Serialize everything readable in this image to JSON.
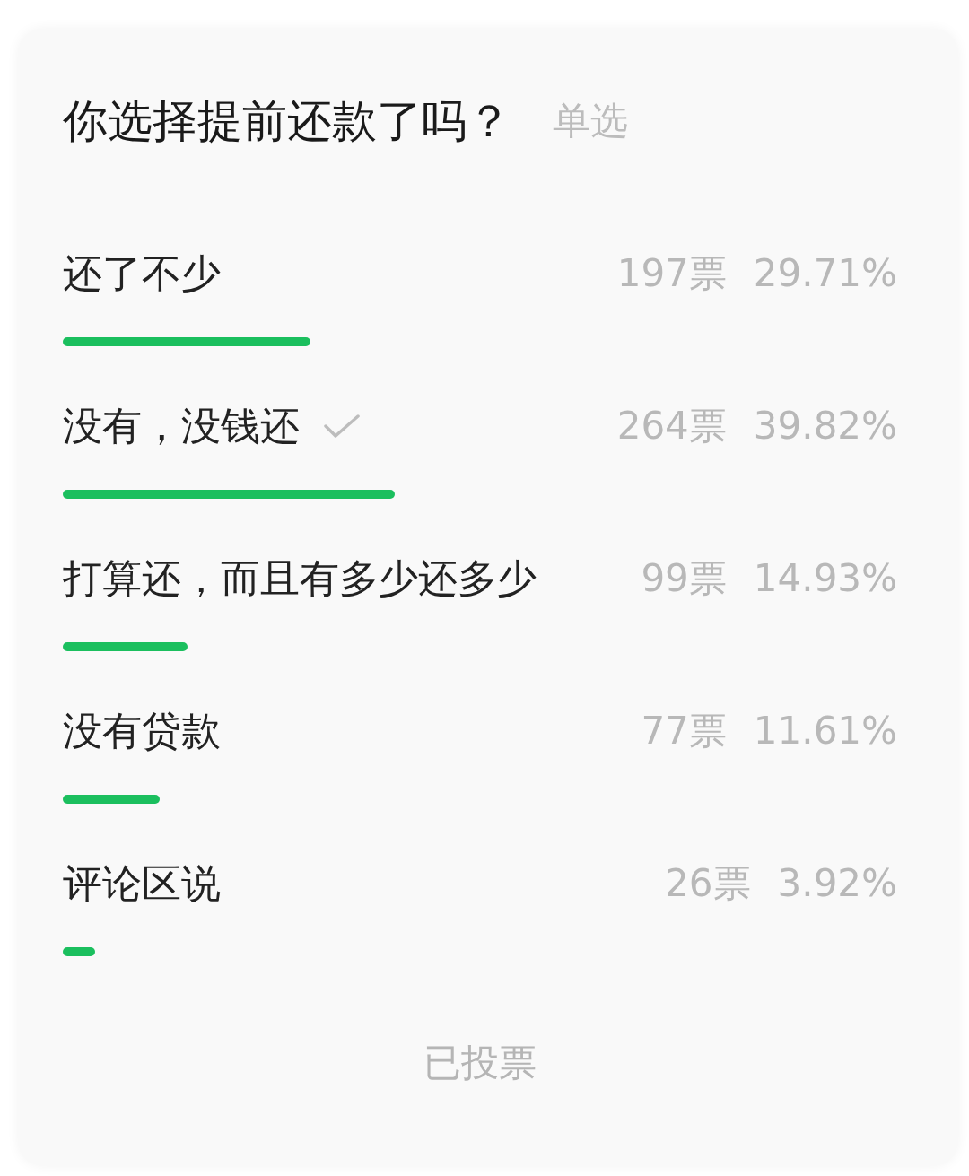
{
  "poll": {
    "question": "你选择提前还款了吗？",
    "mode": "单选",
    "options": [
      {
        "label": "还了不少",
        "votes": "197票",
        "percent": "29.71%",
        "level": 0.2971,
        "selected": false
      },
      {
        "label": "没有，没钱还",
        "votes": "264票",
        "percent": "39.82%",
        "level": 0.3982,
        "selected": true
      },
      {
        "label": "打算还，而且有多少还多少",
        "votes": "99票",
        "percent": "14.93%",
        "level": 0.1493,
        "selected": false
      },
      {
        "label": "没有贷款",
        "votes": "77票",
        "percent": "11.61%",
        "level": 0.1161,
        "selected": false
      },
      {
        "label": "评论区说",
        "votes": "26票",
        "percent": "3.92%",
        "level": 0.0392,
        "selected": false
      }
    ],
    "status": "已投票"
  }
}
